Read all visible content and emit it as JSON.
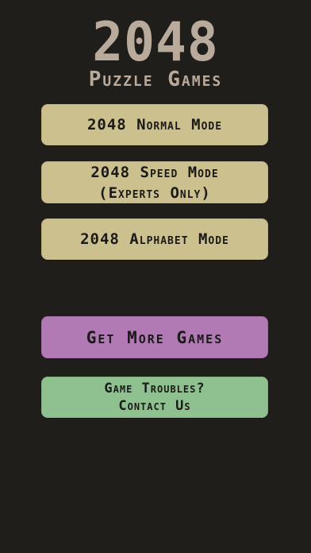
{
  "header": {
    "title": "2048",
    "subtitle": "Puzzle Games"
  },
  "menu": {
    "normal_mode": "2048 Normal Mode",
    "speed_mode_line1": "2048 Speed Mode",
    "speed_mode_line2": "(Experts Only)",
    "alphabet_mode": "2048 Alphabet Mode",
    "more_games": "Get More Games",
    "troubles_line1": "Game Troubles?",
    "troubles_line2": "Contact Us"
  },
  "colors": {
    "background": "#201e1b",
    "title_text": "#b9ab9c",
    "mode_button": "#cdc08f",
    "more_games_button": "#b27ab5",
    "contact_button": "#8fc08f"
  }
}
